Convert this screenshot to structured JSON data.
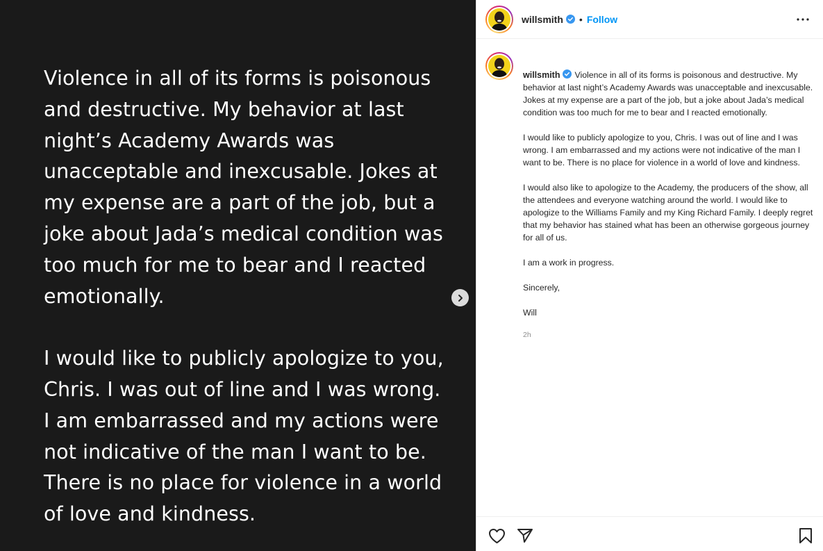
{
  "media": {
    "paragraphs": [
      "Violence in all of its forms is poisonous\nand destructive. My behavior at last\nnight’s Academy Awards was\nunacceptable and inexcusable. Jokes at\nmy expense are a part of the job, but a\njoke about Jada’s medical condition was\ntoo much for me to bear and I reacted\nemotionally.",
      "I would like to publicly apologize to you,\nChris. I was out of line and I was wrong.\nI am embarrassed and my actions were\nnot indicative of the man I want to be.\nThere is no place for violence in a world\nof love and kindness."
    ],
    "next_icon": "chevron-right-icon"
  },
  "header": {
    "username": "willsmith",
    "verified": true,
    "separator": "•",
    "follow_label": "Follow",
    "more_icon": "more-horizontal-icon"
  },
  "caption": {
    "username": "willsmith",
    "first_paragraph": "Violence in all of its forms is poisonous and destructive. My behavior at last night’s Academy Awards was unacceptable and inexcusable. Jokes at my expense are a part of the job, but a joke about Jada’s medical condition was too much for me to bear and I reacted emotionally.",
    "paragraphs": [
      "I would like to publicly apologize to you, Chris. I was out of line and I was wrong. I am embarrassed and my actions were not indicative of the man I want to be. There is no place for violence in a world of love and kindness.",
      "I would also like to apologize to the Academy, the producers of the show, all the attendees and everyone watching around the world. I would like to apologize to the Williams Family and my King Richard Family. I deeply regret that my behavior has stained what has been an otherwise gorgeous journey for all of us.",
      "I am a work in progress.",
      "Sincerely,",
      "Will"
    ],
    "timestamp": "2h"
  },
  "actions": {
    "like_icon": "heart-icon",
    "share_icon": "send-icon",
    "save_icon": "bookmark-icon"
  },
  "colors": {
    "media_bg": "#1a1a1a",
    "accent": "#0095f6",
    "verified": "#3897f0"
  }
}
